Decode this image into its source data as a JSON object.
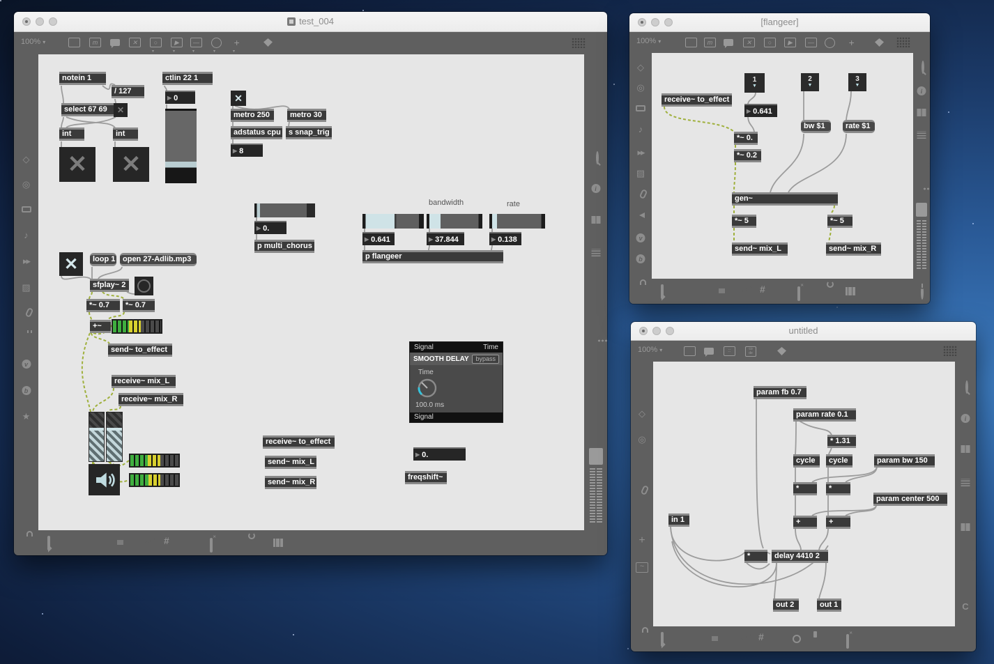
{
  "colors": {
    "desktop_blue": "#2b5f9e",
    "canvas_gray": "#e6e6e6",
    "chrome_gray": "#5f5f5f",
    "box_dark": "#3a3a3a",
    "accent_light_blue": "#cfe3e7",
    "meter_green": "#3fae3f",
    "meter_yellow": "#d8d02f",
    "knob_cyan": "#35c3dc",
    "signal_cord_yellow": "#9fb03c"
  },
  "icons": {
    "toggle_x": "✕",
    "number_triangle": "▶",
    "inlet_triangle": "▼",
    "caret_down": "▾",
    "console_m": "m",
    "object_play": "▶",
    "object_circle": "○",
    "object_dash": "—",
    "add_plus": "+",
    "audio_note": "♪",
    "star": "★",
    "package": "◇",
    "vinyl": "◎",
    "sequencer": "▸▸",
    "image": "▨",
    "grid_hash": "#",
    "code_top": "co",
    "code_bottom": "de",
    "vizzie_v": "v",
    "beap_b": "b",
    "refresh_c": "C",
    "gen_tilde": "~"
  },
  "windows": {
    "test004": {
      "title": "test_004",
      "zoom_level": "100%",
      "patch": {
        "notein": "notein 1",
        "div127": "/ 127",
        "select": "select 67 69",
        "int1": "int",
        "int2": "int",
        "ctlin": "ctlin 22 1",
        "ctl_value": "0",
        "metro250": "metro 250",
        "metro30": "metro 30",
        "adstatus": "adstatus cpu",
        "snap_send": "s snap_trig",
        "cpu_value": "8",
        "chorus_value": "0.",
        "p_multi_chorus": "p multi_chorus",
        "bandwidth_label": "bandwidth",
        "rate_label": "rate",
        "depth_value": "0.641",
        "bandwidth_value": "37.844",
        "rate_value": "0.138",
        "p_flangeer": "p flangeer",
        "loop_msg": "loop 1",
        "open_msg": "open 27-Adlib.mp3",
        "sfplay": "sfplay~ 2",
        "mul_left": "*~ 0.7",
        "mul_right": "*~ 0.7",
        "add_sig": "+~",
        "send_effect": "send~ to_effect",
        "recv_mix_l": "receive~ mix_L",
        "recv_mix_r": "receive~ mix_R",
        "recv_effect": "receive~ to_effect",
        "send_mix_l": "send~ mix_L",
        "send_mix_r": "send~ mix_R",
        "freq_value": "0.",
        "freqshift": "freqshift~"
      },
      "delay_device": {
        "header_left": "Signal",
        "header_right": "Time",
        "name": "SMOOTH DELAY",
        "bypass_label": "bypass",
        "knob_label": "Time",
        "knob_value": "100.0 ms",
        "footer": "Signal"
      }
    },
    "flangeer": {
      "title": "[flangeer]",
      "zoom_level": "100%",
      "patch": {
        "inlet1": "1",
        "inlet2": "2",
        "inlet3": "3",
        "recv_effect": "receive~ to_effect",
        "depth_value": "0.641",
        "bw_msg": "bw $1",
        "rate_msg": "rate $1",
        "mul_depth": "*~ 0.",
        "mul_02": "*~ 0.2",
        "gen": "gen~",
        "mul5_left": "*~ 5",
        "mul5_right": "*~ 5",
        "send_mix_l": "send~ mix_L",
        "send_mix_r": "send~ mix_R"
      }
    },
    "untitled": {
      "title": "untitled",
      "zoom_level": "100%",
      "patch": {
        "param_fb": "param fb 0.7",
        "param_rate": "param rate 0.1",
        "mul_131": "* 1.31",
        "cycle1": "cycle",
        "cycle2": "cycle",
        "param_bw": "param bw 150",
        "param_center": "param center 500",
        "in1": "in 1",
        "mul_a": "*",
        "mul_b": "*",
        "mul_fb": "*",
        "add_a": "+",
        "add_b": "+",
        "delay": "delay 4410 2",
        "out2": "out 2",
        "out1": "out 1"
      }
    }
  }
}
